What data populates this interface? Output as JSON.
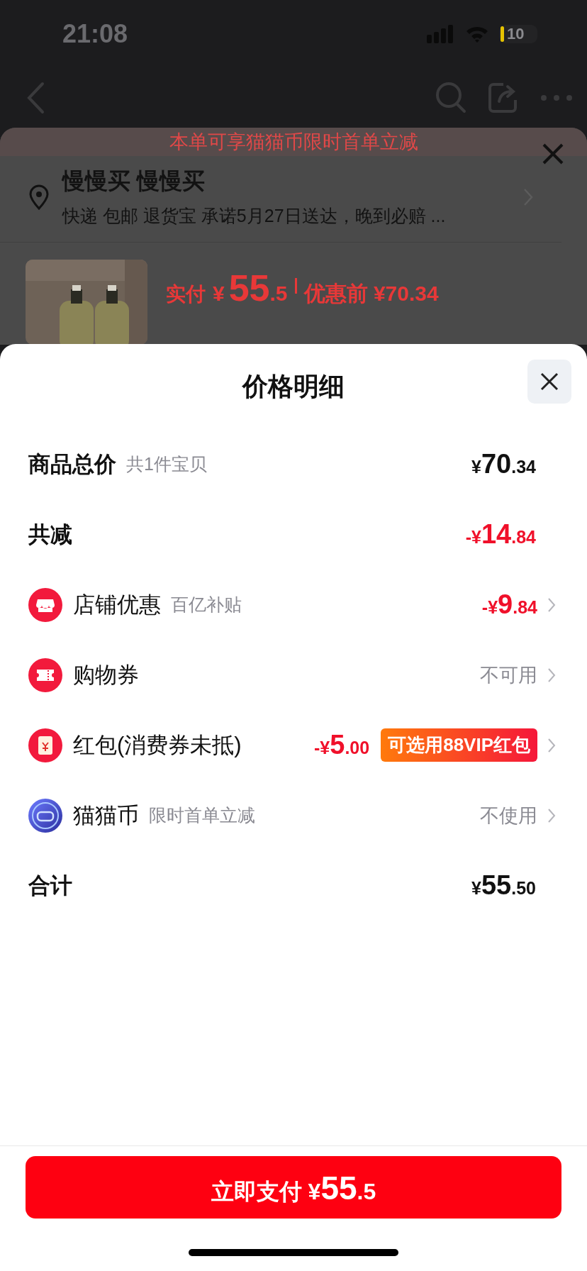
{
  "status_bar": {
    "time": "21:08",
    "battery": "10"
  },
  "order": {
    "banner": "本单可享猫猫币限时首单立减",
    "address": {
      "name": "慢慢买 慢慢买",
      "detail": "快递 包邮 退货宝 承诺5月27日送达，晚到必赔 ..."
    },
    "product": {
      "kind": "picture",
      "paid_label": "实付",
      "currency": "¥",
      "whole": "55",
      "fraction": ".5",
      "before_label": "优惠前",
      "before_price": "¥70.34"
    }
  },
  "sheet": {
    "title": "价格明细",
    "rows": [
      {
        "kind": "summary",
        "label": "商品总价",
        "note": "共1件宝贝",
        "amount": {
          "sign": "¥",
          "whole": "70",
          "fraction": ".34"
        },
        "negative": false
      },
      {
        "kind": "summary",
        "label": "共减",
        "amount": {
          "sign": "-¥",
          "whole": "14",
          "fraction": ".84"
        },
        "negative": true
      },
      {
        "kind": "option",
        "label": "店铺优惠",
        "note": "百亿补贴",
        "amount": {
          "sign": "-¥",
          "whole": "9",
          "fraction": ".84"
        },
        "negative": true
      },
      {
        "kind": "option",
        "label": "购物券",
        "status": "不可用"
      },
      {
        "kind": "option",
        "label": "红包(消费券未抵)",
        "amount": {
          "sign": "-¥",
          "whole": "5",
          "fraction": ".00"
        },
        "negative": true,
        "badge": "可选用88VIP红包"
      },
      {
        "kind": "option",
        "label": "猫猫币",
        "note": "限时首单立减",
        "status": "不使用"
      },
      {
        "kind": "summary",
        "label": "合计",
        "amount": {
          "sign": "¥",
          "whole": "55",
          "fraction": ".50"
        },
        "negative": false
      }
    ],
    "pay_button": {
      "label": "立即支付",
      "currency": "¥",
      "whole": "55",
      "fraction": ".5"
    }
  }
}
